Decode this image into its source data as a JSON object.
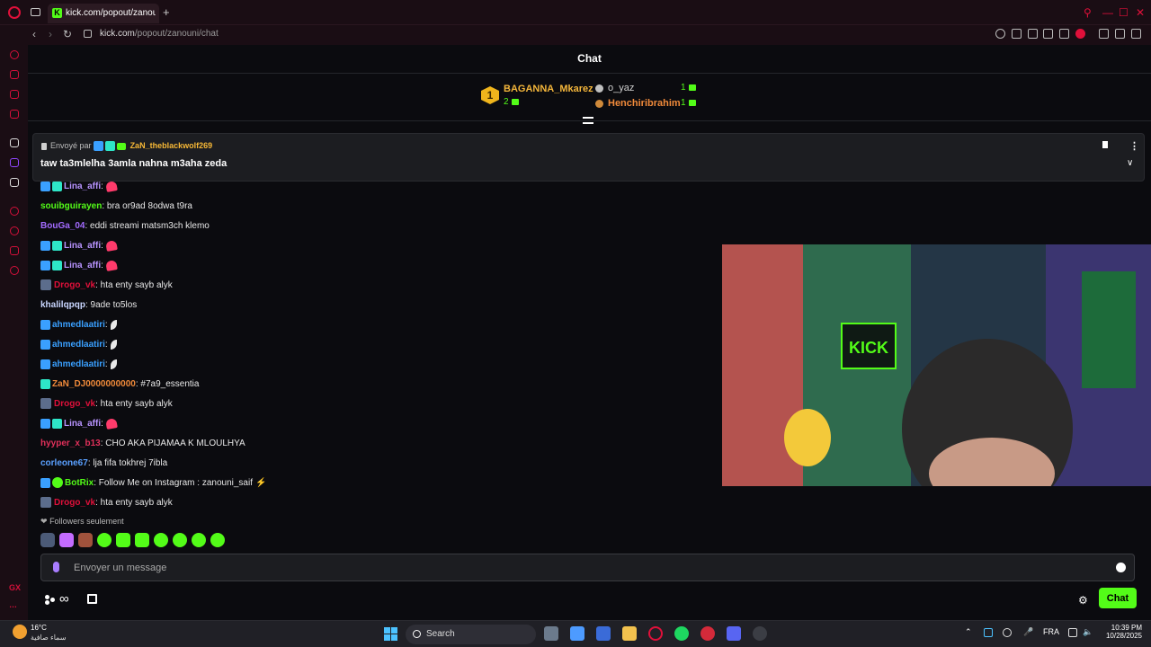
{
  "browser": {
    "tab_title": "kick.com/popout/zanouni",
    "tab_favicon": "K",
    "new_tab": "+",
    "url_host": "kick.com",
    "url_path": "/popout/zanouni/chat"
  },
  "sidebar": {
    "bottom_label": "GX"
  },
  "chat": {
    "title": "Chat",
    "leaderboard": [
      {
        "rank": "1",
        "name": "BAGANNA_Mkarez",
        "count": "2"
      },
      {
        "name": "o_yaz",
        "count": "1"
      },
      {
        "name": "Henchiribrahim",
        "count": "1"
      }
    ],
    "pinned": {
      "sent_by_label": "Envoyé par",
      "user": "ZaN_theblackwolf269",
      "message": "taw ta3mlelha 3amla nahna m3aha zeda"
    },
    "messages": [
      {
        "user": "Lina_affi",
        "text": ":",
        "color": "#b894ff"
      },
      {
        "user": "souibguirayen",
        "text": ": bra or9ad 8odwa t9ra",
        "color": "#53fc18"
      },
      {
        "user": "BouGa_04",
        "text": ": eddi streami matsm3ch klemo",
        "color": "#a36bff"
      },
      {
        "user": "Lina_affi",
        "text": ":",
        "color": "#b894ff"
      },
      {
        "user": "Lina_affi",
        "text": ":",
        "color": "#b894ff"
      },
      {
        "user": "Drogo_vk",
        "text": ": hta enty sayb alyk",
        "color": "#e0103a"
      },
      {
        "user": "khalilqpqp",
        "text": ": 9ade to5los",
        "color": "#c9d6ff"
      },
      {
        "user": "ahmedlaatiri",
        "text": ":",
        "color": "#3aa0ff"
      },
      {
        "user": "ahmedlaatiri",
        "text": ":",
        "color": "#3aa0ff"
      },
      {
        "user": "ahmedlaatiri",
        "text": ":",
        "color": "#3aa0ff"
      },
      {
        "user": "ZaN_DJ0000000000",
        "text": ": #7a9_essentia",
        "color": "#f08a3a"
      },
      {
        "user": "Drogo_vk",
        "text": ": hta enty sayb alyk",
        "color": "#e0103a"
      },
      {
        "user": "Lina_affi",
        "text": ":",
        "color": "#b894ff"
      },
      {
        "user": "hyyper_x_b13",
        "text": ": CHO AKA PIJAMAA K MLOULHYA",
        "color": "#e0305a"
      },
      {
        "user": "corleone67",
        "text": ": lja fifa tokhrej 7ibla",
        "color": "#5aa0ff"
      },
      {
        "user": "BotRix",
        "text": ": Follow Me on Instagram : zanouni_saif",
        "color": "#53fc18"
      },
      {
        "user": "Drogo_vk",
        "text": ": hta enty sayb alyk",
        "color": "#e0103a"
      }
    ],
    "followers_only": "Followers seulement",
    "input_placeholder": "Envoyer un message",
    "send_button": "Chat"
  },
  "video": {
    "sign_text": "KICK"
  },
  "taskbar": {
    "temperature": "16°C",
    "weather_desc": "سماء صافية",
    "search_label": "Search",
    "language": "FRA",
    "time": "10:39 PM",
    "date": "10/28/2025"
  },
  "colors": {
    "accent": "#53fc18",
    "opera_red": "#e0103a"
  }
}
